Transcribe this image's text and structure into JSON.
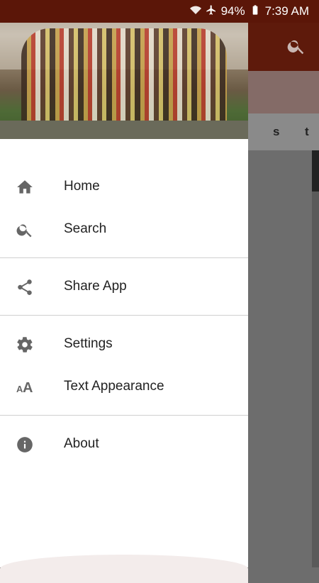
{
  "status_bar": {
    "battery": "94%",
    "time": "7:39 AM"
  },
  "background_app": {
    "tab_letters": [
      "s",
      "t"
    ]
  },
  "drawer": {
    "items": [
      {
        "label": "Home",
        "icon": "home-icon"
      },
      {
        "label": "Search",
        "icon": "search-icon"
      },
      {
        "label": "Share App",
        "icon": "share-icon"
      },
      {
        "label": "Settings",
        "icon": "gear-icon"
      },
      {
        "label": "Text Appearance",
        "icon": "text-size-icon"
      },
      {
        "label": "About",
        "icon": "info-icon"
      }
    ]
  },
  "colors": {
    "toolbar": "#5e1a0b",
    "icon_gray": "#666666",
    "scrim": "#6d6d6d"
  }
}
